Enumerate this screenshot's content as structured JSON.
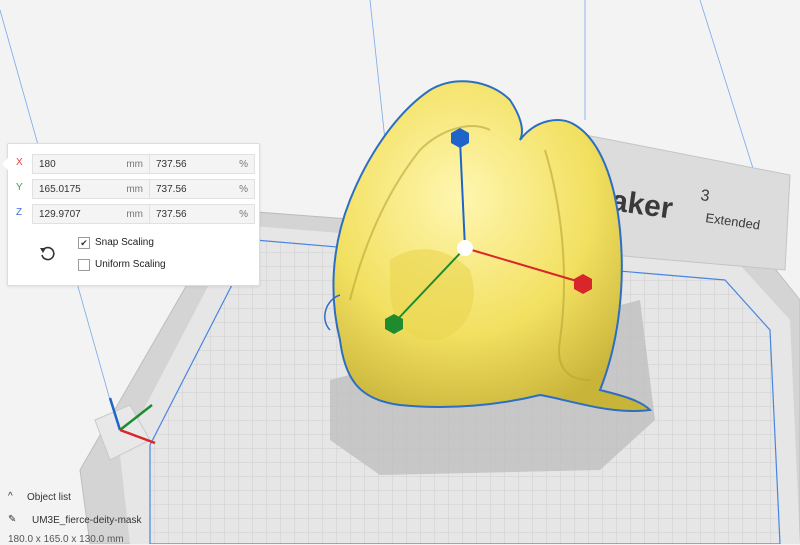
{
  "scale_panel": {
    "rows": [
      {
        "axis": "X",
        "axis_color": "#e04040",
        "value": "180",
        "unit": "mm",
        "percent": "737.56",
        "percent_unit": "%"
      },
      {
        "axis": "Y",
        "axis_color": "#3aa040",
        "value": "165.0175",
        "unit": "mm",
        "percent": "737.56",
        "percent_unit": "%"
      },
      {
        "axis": "Z",
        "axis_color": "#3a6fd8",
        "value": "129.9707",
        "unit": "mm",
        "percent": "737.56",
        "percent_unit": "%"
      }
    ],
    "snap_scaling": {
      "label": "Snap Scaling",
      "checked": true,
      "mark": "✔"
    },
    "uniform_scaling": {
      "label": "Uniform Scaling",
      "checked": false
    }
  },
  "icons": {
    "reset": "reset-icon",
    "chevron": "chevron-up-icon",
    "pencil": "pencil-icon"
  },
  "object_list": {
    "title": "Object list",
    "object_name": "UM3E_fierce-deity-mask",
    "dimensions": "180.0 x 165.0 x 130.0 mm"
  },
  "printer_brand": {
    "text_main": "aker",
    "superscript": "3",
    "text_sub": "Extended"
  },
  "colors": {
    "model_yellow": "#f5e66a",
    "outline_blue": "#2c6fc0",
    "handle_x": "#d8262b",
    "handle_y": "#1e8b2f",
    "handle_z": "#1f64c8"
  }
}
